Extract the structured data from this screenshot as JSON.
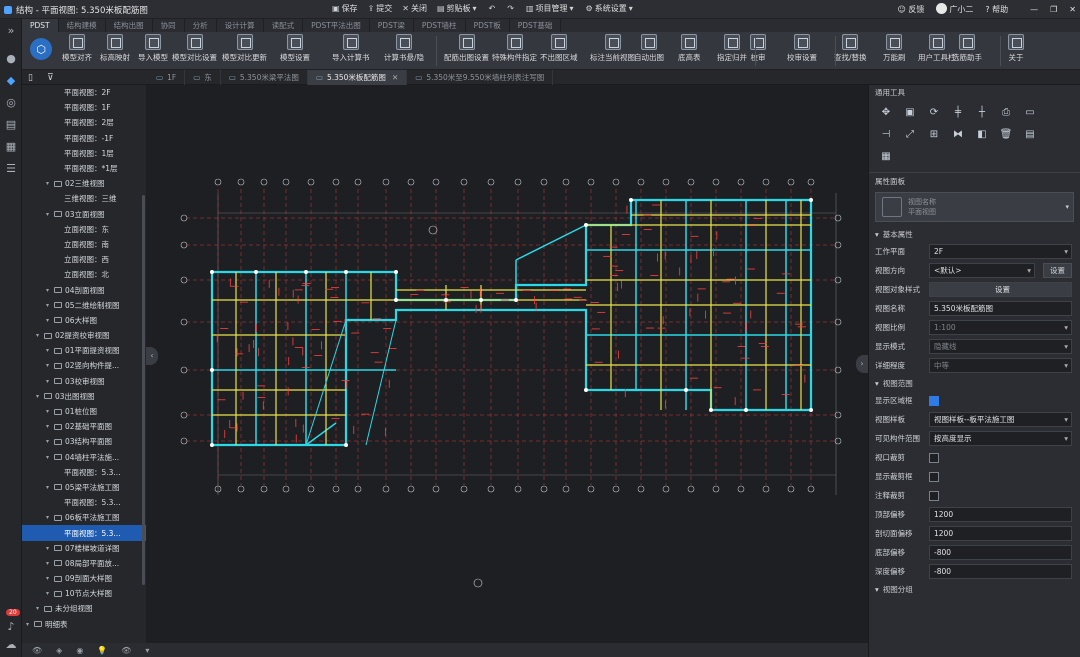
{
  "window": {
    "title": "结构 - 平面视图: 5.350米板配筋图",
    "quick": [
      "保存",
      "提交",
      "关闭",
      "剪贴板",
      "项目管理",
      "系统设置"
    ],
    "right": [
      "反馈",
      "广小二",
      "帮助"
    ]
  },
  "ribbon_tabs": [
    "PDST",
    "结构建模",
    "结构出图",
    "协同",
    "分析",
    "设计计算",
    "读配式",
    "PDST平法出图",
    "PDST梁",
    "PDST墙柱",
    "PDST板",
    "PDST基础"
  ],
  "ribbon_buttons": [
    "模型对齐",
    "标高映射",
    "导入模型",
    "模型对比设置",
    "模型对比更新",
    "模型设置",
    "导入计算书",
    "计算书悬/隐",
    "配筋出图设置",
    "特殊构件指定",
    "不出图区域",
    "标注当前视图",
    "自动出图",
    "底高表",
    "指定归并",
    "校审",
    "校审设置",
    "查找/替换",
    "万能刷",
    "用户工具栏",
    "选筋助手",
    "关于"
  ],
  "doc_tabs": [
    {
      "label": "1F"
    },
    {
      "label": "东"
    },
    {
      "label": "5.350米梁平法图"
    },
    {
      "label": "5.350米板配筋图",
      "active": true
    },
    {
      "label": "5.350米至9.550米墙柱列表注写图"
    }
  ],
  "tree": [
    {
      "label": "平面视图：2F",
      "depth": 3
    },
    {
      "label": "平面视图：1F",
      "depth": 3
    },
    {
      "label": "平面视图：2层",
      "depth": 3
    },
    {
      "label": "平面视图：-1F",
      "depth": 3
    },
    {
      "label": "平面视图：1层",
      "depth": 3
    },
    {
      "label": "平面视图：*1层",
      "depth": 3
    },
    {
      "label": "02三维视图",
      "depth": 2,
      "folder": true
    },
    {
      "label": "三维视图：三维",
      "depth": 3
    },
    {
      "label": "03立面视图",
      "depth": 2,
      "folder": true
    },
    {
      "label": "立面视图：东",
      "depth": 3
    },
    {
      "label": "立面视图：南",
      "depth": 3
    },
    {
      "label": "立面视图：西",
      "depth": 3
    },
    {
      "label": "立面视图：北",
      "depth": 3
    },
    {
      "label": "04剖面视图",
      "depth": 2,
      "folder": true
    },
    {
      "label": "05二维绘制视图",
      "depth": 2,
      "folder": true
    },
    {
      "label": "06大样图",
      "depth": 2,
      "folder": true
    },
    {
      "label": "02提资校审视图",
      "depth": 1,
      "folder": true
    },
    {
      "label": "01平面提资视图",
      "depth": 2,
      "folder": true
    },
    {
      "label": "02竖向构件提...",
      "depth": 2,
      "folder": true
    },
    {
      "label": "03校审视图",
      "depth": 2,
      "folder": true
    },
    {
      "label": "03出图视图",
      "depth": 1,
      "folder": true
    },
    {
      "label": "01桩位图",
      "depth": 2,
      "folder": true
    },
    {
      "label": "02基础平面图",
      "depth": 2,
      "folder": true
    },
    {
      "label": "03结构平面图",
      "depth": 2,
      "folder": true
    },
    {
      "label": "04墙柱平法施...",
      "depth": 2,
      "folder": true
    },
    {
      "label": "平面视图：5.3...",
      "depth": 3
    },
    {
      "label": "05梁平法施工图",
      "depth": 2,
      "folder": true
    },
    {
      "label": "平面视图：5.3...",
      "depth": 3
    },
    {
      "label": "06板平法施工图",
      "depth": 2,
      "folder": true
    },
    {
      "label": "平面视图：5.3...",
      "depth": 3,
      "selected": true
    },
    {
      "label": "07楼梯坡道详图",
      "depth": 2,
      "folder": true
    },
    {
      "label": "08局部平面放...",
      "depth": 2,
      "folder": true
    },
    {
      "label": "09剖面大样图",
      "depth": 2,
      "folder": true
    },
    {
      "label": "10节点大样图",
      "depth": 2,
      "folder": true
    },
    {
      "label": "未分组视图",
      "depth": 1,
      "folder": true
    },
    {
      "label": "明细表",
      "depth": 0,
      "folder": true
    }
  ],
  "notification_count": "20",
  "panel": {
    "tools_title": "通用工具",
    "props_title": "属性面板",
    "selector_lines": [
      "视图名称",
      "平面视图"
    ],
    "basic_title": "基本属性",
    "rows": [
      {
        "label": "工作平面",
        "value": "2F",
        "type": "select"
      },
      {
        "label": "视图方向",
        "value": "<默认>",
        "type": "select",
        "button": "设置"
      },
      {
        "label": "视图对象样式",
        "value": "",
        "type": "button",
        "button": "设置"
      },
      {
        "label": "视图名称",
        "value": "5.350米板配筋图",
        "type": "text"
      },
      {
        "label": "视图比例",
        "value": "1:100",
        "type": "select",
        "dim": true
      },
      {
        "label": "显示模式",
        "value": "隐藏线",
        "type": "select",
        "dim": true
      },
      {
        "label": "详细程度",
        "value": "中等",
        "type": "select",
        "dim": true
      }
    ],
    "range_title": "视图范围",
    "range_rows": [
      {
        "label": "显示区域框",
        "type": "check",
        "checked": true
      },
      {
        "label": "视图样板",
        "value": "视图样板--板平法施工图",
        "type": "select"
      },
      {
        "label": "可见构件范围",
        "value": "按高度显示",
        "type": "select"
      },
      {
        "label": "视口裁剪",
        "type": "check",
        "checked": false
      },
      {
        "label": "显示裁剪框",
        "type": "check",
        "checked": false
      },
      {
        "label": "注释裁剪",
        "type": "check",
        "checked": false
      },
      {
        "label": "顶部偏移",
        "value": "1200",
        "type": "text"
      },
      {
        "label": "剖切面偏移",
        "value": "1200",
        "type": "text"
      },
      {
        "label": "底部偏移",
        "value": "-800",
        "type": "text"
      },
      {
        "label": "深度偏移",
        "value": "-800",
        "type": "text"
      }
    ],
    "group_title": "视图分组"
  }
}
